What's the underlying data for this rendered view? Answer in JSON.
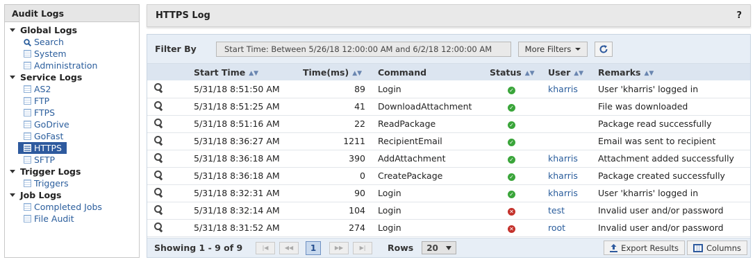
{
  "sidebar": {
    "title": "Audit Logs",
    "groups": [
      {
        "label": "Global Logs",
        "items": [
          {
            "label": "Search",
            "icon": "search-icon"
          },
          {
            "label": "System",
            "icon": "document-icon"
          },
          {
            "label": "Administration",
            "icon": "document-icon"
          }
        ]
      },
      {
        "label": "Service Logs",
        "items": [
          {
            "label": "AS2",
            "icon": "document-icon"
          },
          {
            "label": "FTP",
            "icon": "document-icon"
          },
          {
            "label": "FTPS",
            "icon": "document-icon"
          },
          {
            "label": "GoDrive",
            "icon": "document-icon"
          },
          {
            "label": "GoFast",
            "icon": "document-icon"
          },
          {
            "label": "HTTPS",
            "icon": "document-icon",
            "active": true
          },
          {
            "label": "SFTP",
            "icon": "document-icon"
          }
        ]
      },
      {
        "label": "Trigger Logs",
        "items": [
          {
            "label": "Triggers",
            "icon": "document-icon"
          }
        ]
      },
      {
        "label": "Job Logs",
        "items": [
          {
            "label": "Completed Jobs",
            "icon": "document-icon"
          },
          {
            "label": "File Audit",
            "icon": "document-icon"
          }
        ]
      }
    ]
  },
  "header": {
    "title": "HTTPS Log",
    "help": "?"
  },
  "filter": {
    "label": "Filter By",
    "value": "Start Time: Between 5/26/18 12:00:00 AM and 6/2/18 12:00:00 AM",
    "more_filters": "More Filters"
  },
  "table": {
    "columns": [
      "Start Time",
      "Time(ms)",
      "Command",
      "Status",
      "User",
      "Remarks"
    ],
    "rows": [
      {
        "start": "5/31/18 8:51:50 AM",
        "ms": "89",
        "command": "Login",
        "status": "success",
        "user": "kharris",
        "remarks": "User 'kharris' logged in"
      },
      {
        "start": "5/31/18 8:51:25 AM",
        "ms": "41",
        "command": "DownloadAttachment",
        "status": "success",
        "user": "",
        "remarks": "File was downloaded"
      },
      {
        "start": "5/31/18 8:51:16 AM",
        "ms": "22",
        "command": "ReadPackage",
        "status": "success",
        "user": "",
        "remarks": "Package read successfully"
      },
      {
        "start": "5/31/18 8:36:27 AM",
        "ms": "1211",
        "command": "RecipientEmail",
        "status": "success",
        "user": "",
        "remarks": "Email was sent to recipient"
      },
      {
        "start": "5/31/18 8:36:18 AM",
        "ms": "390",
        "command": "AddAttachment",
        "status": "success",
        "user": "kharris",
        "remarks": "Attachment added successfully"
      },
      {
        "start": "5/31/18 8:36:18 AM",
        "ms": "0",
        "command": "CreatePackage",
        "status": "success",
        "user": "kharris",
        "remarks": "Package created successfully"
      },
      {
        "start": "5/31/18 8:32:31 AM",
        "ms": "90",
        "command": "Login",
        "status": "success",
        "user": "kharris",
        "remarks": "User 'kharris' logged in"
      },
      {
        "start": "5/31/18 8:32:14 AM",
        "ms": "104",
        "command": "Login",
        "status": "error",
        "user": "test",
        "remarks": "Invalid user and/or password"
      },
      {
        "start": "5/31/18 8:31:52 AM",
        "ms": "274",
        "command": "Login",
        "status": "error",
        "user": "root",
        "remarks": "Invalid user and/or password"
      }
    ]
  },
  "footer": {
    "showing": "Showing 1 - 9 of 9",
    "page": "1",
    "rows_label": "Rows",
    "rows_value": "20",
    "export": "Export Results",
    "columns": "Columns"
  },
  "colors": {
    "accent": "#2e5a9e",
    "success": "#3aa53a",
    "error": "#c4312b",
    "link": "#2a5d9c"
  }
}
